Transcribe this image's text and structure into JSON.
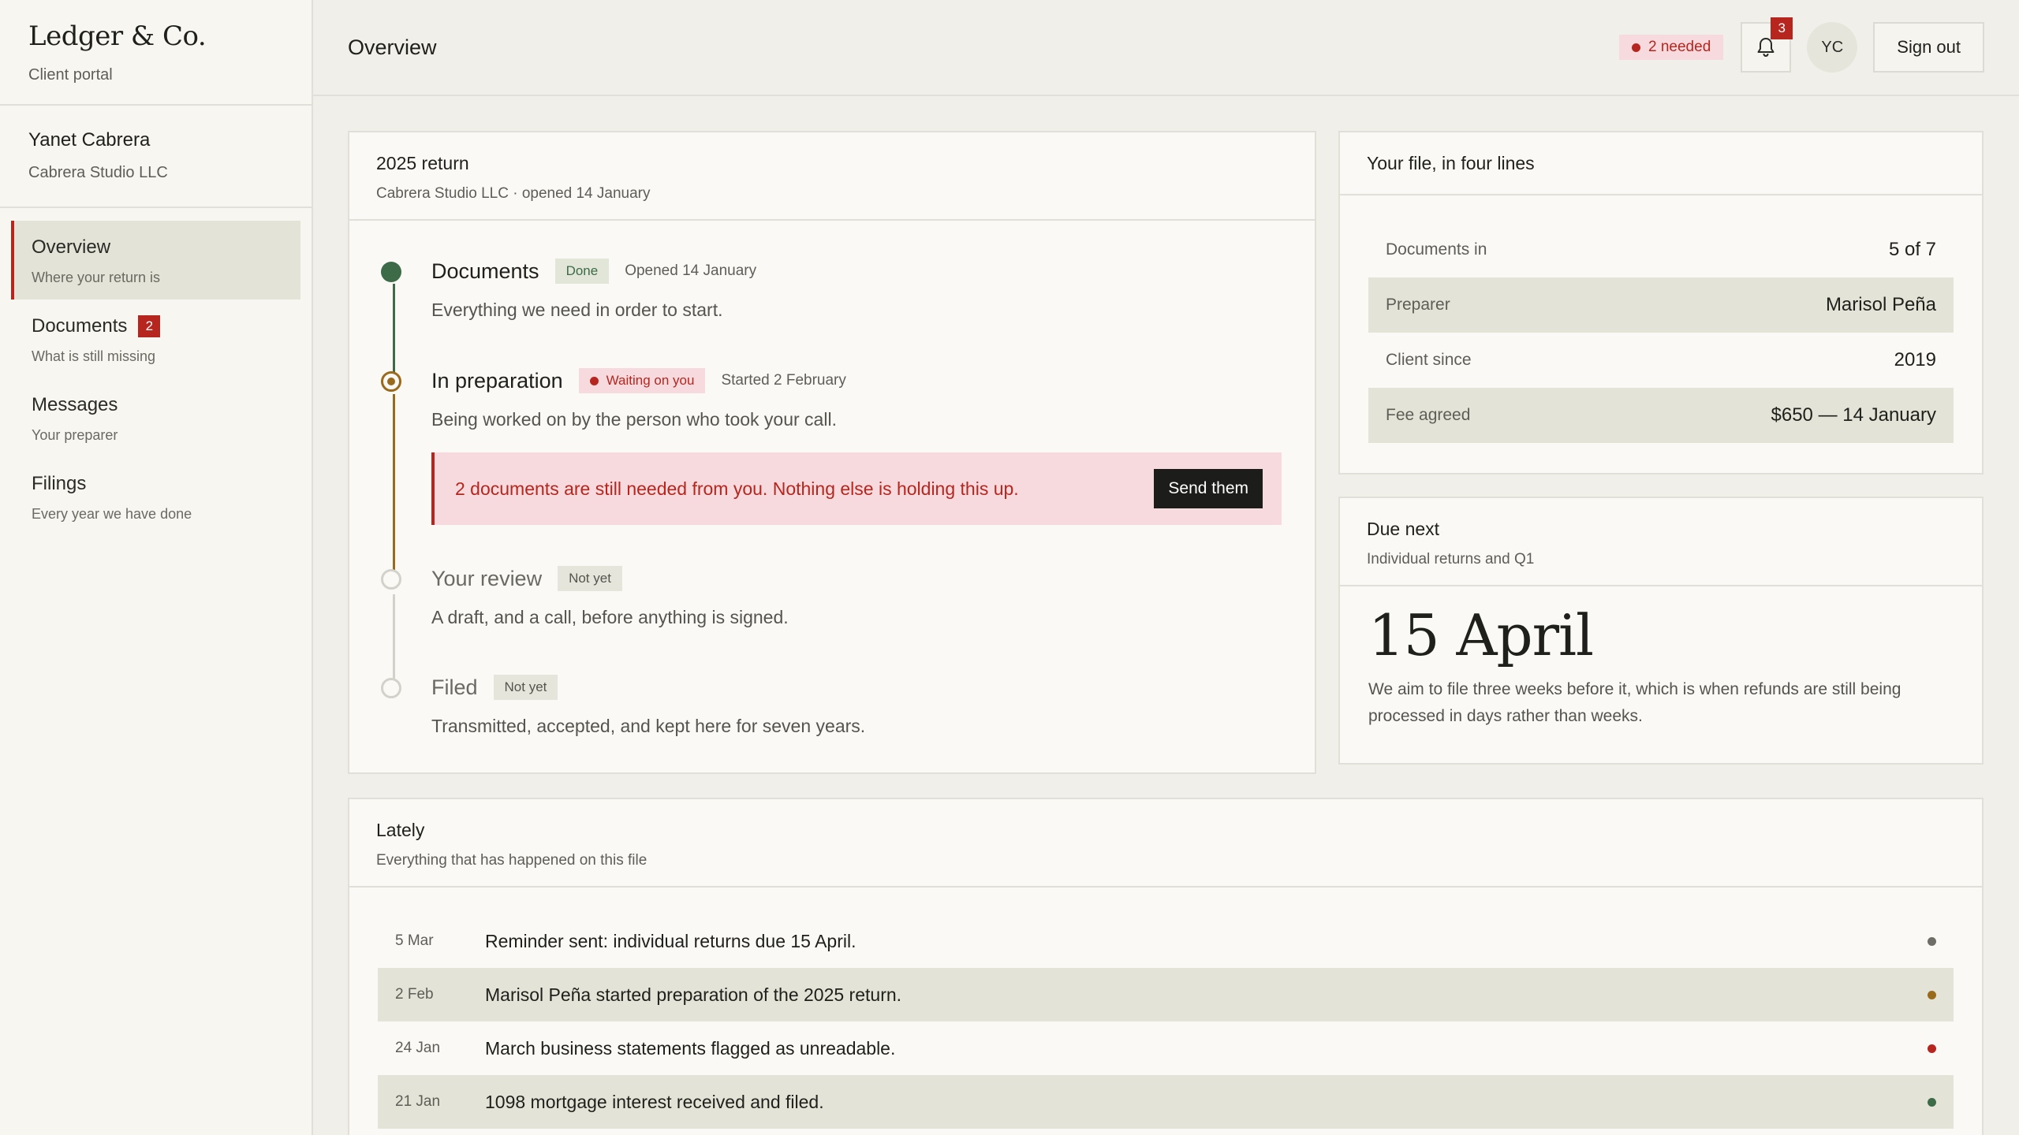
{
  "brand": {
    "name": "Ledger & Co.",
    "subtitle": "Client portal"
  },
  "client": {
    "name": "Yanet Cabrera",
    "company": "Cabrera Studio LLC"
  },
  "nav": [
    {
      "label": "Overview",
      "sub": "Where your return is",
      "active": true,
      "badge": ""
    },
    {
      "label": "Documents",
      "sub": "What is still missing",
      "active": false,
      "badge": "2"
    },
    {
      "label": "Messages",
      "sub": "Your preparer",
      "active": false,
      "badge": ""
    },
    {
      "label": "Filings",
      "sub": "Every year we have done",
      "active": false,
      "badge": ""
    }
  ],
  "header": {
    "title": "Overview",
    "needed": "2 needed",
    "notifications": "3",
    "avatar_initials": "YC",
    "signout": "Sign out"
  },
  "return_card": {
    "title": "2025 return",
    "subtitle": "Cabrera Studio LLC · opened 14 January",
    "stages": [
      {
        "name": "Documents",
        "tag": "Done",
        "date": "Opened 14 January",
        "desc": "Everything we need in order to start."
      },
      {
        "name": "In preparation",
        "tag": "Waiting on you",
        "date": "Started 2 February",
        "desc": "Being worked on by the person who took your call."
      },
      {
        "name": "Your review",
        "tag": "Not yet",
        "date": "",
        "desc": "A draft, and a call, before anything is signed."
      },
      {
        "name": "Filed",
        "tag": "Not yet",
        "date": "",
        "desc": "Transmitted, accepted, and kept here for seven years."
      }
    ],
    "alert": {
      "text": "2 documents are still needed from you. Nothing else is holding this up.",
      "button": "Send them"
    }
  },
  "file_card": {
    "title": "Your file, in four lines",
    "rows": [
      {
        "key": "Documents in",
        "value": "5 of 7"
      },
      {
        "key": "Preparer",
        "value": "Marisol Peña"
      },
      {
        "key": "Client since",
        "value": "2019"
      },
      {
        "key": "Fee agreed",
        "value": "$650 — 14 January"
      }
    ]
  },
  "due_card": {
    "title": "Due next",
    "subtitle": "Individual returns and Q1",
    "date": "15 April",
    "text": "We aim to file three weeks before it, which is when refunds are still being processed in days rather than weeks."
  },
  "lately": {
    "title": "Lately",
    "subtitle": "Everything that has happened on this file",
    "events": [
      {
        "date": "5 Mar",
        "text": "Reminder sent: individual returns due 15 April.",
        "dot_color": "#6e6d66"
      },
      {
        "date": "2 Feb",
        "text": "Marisol Peña started preparation of the 2025 return.",
        "dot_color": "#9a6a1c"
      },
      {
        "date": "24 Jan",
        "text": "March business statements flagged as unreadable.",
        "dot_color": "#b6261f"
      },
      {
        "date": "21 Jan",
        "text": "1098 mortgage interest received and filed.",
        "dot_color": "#3d6b47"
      }
    ]
  },
  "colors": {
    "accent_red": "#b6261f",
    "done_green": "#3d6b47",
    "progress_amber": "#9a6a1c",
    "highlight_row": "#e3e3d7"
  }
}
